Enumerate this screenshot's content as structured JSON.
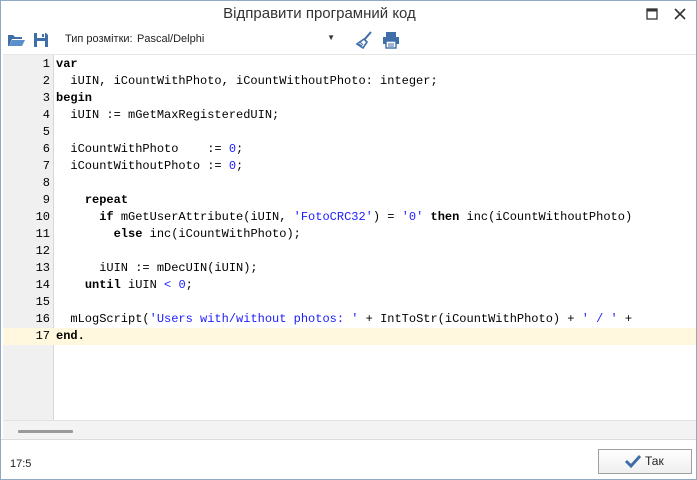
{
  "window": {
    "title": "Відправити програмний код",
    "maximize_icon": "□",
    "close_icon": "✕"
  },
  "toolbar": {
    "open_icon": "folder-open",
    "save_icon": "floppy-disk",
    "format_label": "Тип розмітки:",
    "format_value": "Pascal/Delphi",
    "format_arrow": "▼",
    "clear_icon": "broom",
    "print_icon": "printer"
  },
  "editor": {
    "current_line": 17,
    "lines": [
      {
        "n": "1",
        "tokens": [
          {
            "t": "var",
            "c": "kw"
          }
        ]
      },
      {
        "n": "2",
        "tokens": [
          {
            "t": "  iUIN, iCountWithPhoto, iCountWithoutPhoto: integer;",
            "c": ""
          }
        ]
      },
      {
        "n": "3",
        "tokens": [
          {
            "t": "begin",
            "c": "kw"
          }
        ]
      },
      {
        "n": "4",
        "tokens": [
          {
            "t": "  iUIN := mGetMaxRegisteredUIN;",
            "c": ""
          }
        ]
      },
      {
        "n": "5",
        "tokens": []
      },
      {
        "n": "6",
        "tokens": [
          {
            "t": "  iCountWithPhoto    := ",
            "c": ""
          },
          {
            "t": "0",
            "c": "num"
          },
          {
            "t": ";",
            "c": ""
          }
        ]
      },
      {
        "n": "7",
        "tokens": [
          {
            "t": "  iCountWithoutPhoto := ",
            "c": ""
          },
          {
            "t": "0",
            "c": "num"
          },
          {
            "t": ";",
            "c": ""
          }
        ]
      },
      {
        "n": "8",
        "tokens": []
      },
      {
        "n": "9",
        "tokens": [
          {
            "t": "    ",
            "c": ""
          },
          {
            "t": "repeat",
            "c": "kw"
          }
        ]
      },
      {
        "n": "10",
        "tokens": [
          {
            "t": "      ",
            "c": ""
          },
          {
            "t": "if",
            "c": "kw"
          },
          {
            "t": " mGetUserAttribute(iUIN, ",
            "c": ""
          },
          {
            "t": "'FotoCRC32'",
            "c": "str"
          },
          {
            "t": ") = ",
            "c": ""
          },
          {
            "t": "'0'",
            "c": "str"
          },
          {
            "t": " ",
            "c": ""
          },
          {
            "t": "then",
            "c": "kw"
          },
          {
            "t": " inc(iCountWithoutPhoto)",
            "c": ""
          }
        ]
      },
      {
        "n": "11",
        "tokens": [
          {
            "t": "        ",
            "c": ""
          },
          {
            "t": "else",
            "c": "kw"
          },
          {
            "t": " inc(iCountWithPhoto);",
            "c": ""
          }
        ]
      },
      {
        "n": "12",
        "tokens": []
      },
      {
        "n": "13",
        "tokens": [
          {
            "t": "      iUIN := mDecUIN(iUIN);",
            "c": ""
          }
        ]
      },
      {
        "n": "14",
        "tokens": [
          {
            "t": "    ",
            "c": ""
          },
          {
            "t": "until",
            "c": "kw"
          },
          {
            "t": " iUIN ",
            "c": ""
          },
          {
            "t": "<",
            "c": "sym"
          },
          {
            "t": " ",
            "c": ""
          },
          {
            "t": "0",
            "c": "num"
          },
          {
            "t": ";",
            "c": ""
          }
        ]
      },
      {
        "n": "15",
        "tokens": []
      },
      {
        "n": "16",
        "tokens": [
          {
            "t": "  mLogScript(",
            "c": ""
          },
          {
            "t": "'Users with/without photos: '",
            "c": "str"
          },
          {
            "t": " + IntToStr(iCountWithPhoto) + ",
            "c": ""
          },
          {
            "t": "' / '",
            "c": "str"
          },
          {
            "t": " +",
            "c": ""
          }
        ]
      },
      {
        "n": "17",
        "tokens": [
          {
            "t": "end.",
            "c": "kw"
          }
        ]
      }
    ]
  },
  "status": {
    "cursor_position": "17:5"
  },
  "ok_button": {
    "label": "Так",
    "icon": "check-mark"
  },
  "colors": {
    "keyword": "#000000",
    "string": "#1c1cff",
    "current_line": "#fff8de",
    "gutter": "#f0f0f0"
  }
}
